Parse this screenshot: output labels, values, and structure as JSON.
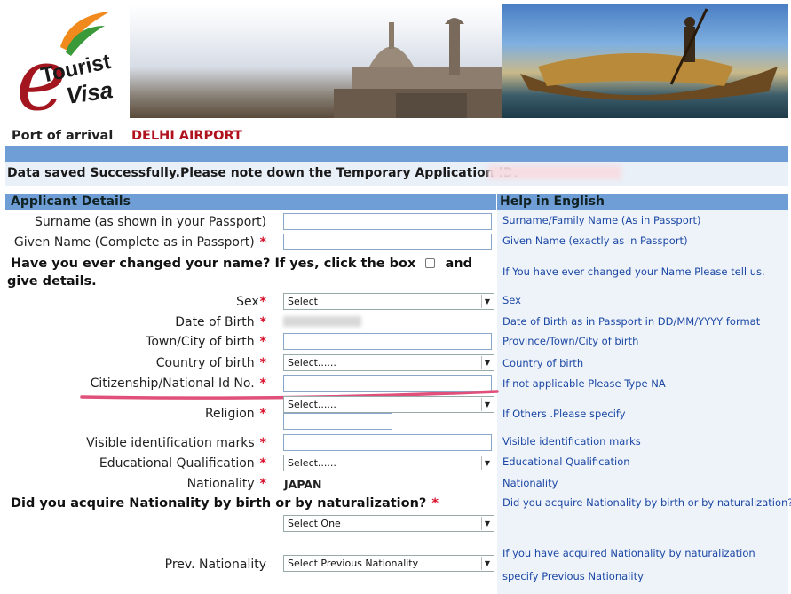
{
  "header": {
    "logo_line1": "e",
    "logo_line2": "Tourist",
    "logo_line3": "Visa"
  },
  "port": {
    "label": "Port of arrival",
    "value": "DELHI AIRPORT"
  },
  "notice": {
    "text": "Data saved Successfully.Please note down the Temporary Application ID:"
  },
  "section": {
    "left_title": "Applicant Details",
    "right_title": "Help in English"
  },
  "fields": {
    "surname_label": "Surname (as shown in your Passport)",
    "surname_help": "Surname/Family Name (As in Passport)",
    "given_label": "Given Name (Complete as in Passport)",
    "given_help": "Given Name (exactly as in Passport)",
    "changed_label_1": "Have you ever changed your name? If yes, click the box",
    "changed_label_and": "and",
    "changed_label_2": "give details.",
    "changed_help": "If You have ever changed your Name Please tell us.",
    "sex_label": "Sex",
    "sex_value": "Select",
    "sex_help": "Sex",
    "dob_label": "Date of Birth",
    "dob_help": "Date of Birth as in Passport in DD/MM/YYYY format",
    "town_label": "Town/City of birth",
    "town_help": "Province/Town/City of birth",
    "country_label": "Country of birth",
    "country_value": "Select......",
    "country_help": "Country of birth",
    "citizen_label": "Citizenship/National Id No.",
    "citizen_help": "If not applicable Please Type NA",
    "religion_label": "Religion",
    "religion_value": "Select......",
    "religion_help": "If Others .Please specify",
    "marks_label": "Visible identification marks",
    "marks_help": "Visible identification marks",
    "edu_label": "Educational Qualification",
    "edu_value": "Select......",
    "edu_help": "Educational Qualification",
    "nationality_label": "Nationality",
    "nationality_value": "JAPAN",
    "nationality_help": "Nationality",
    "acquire_label": "Did you acquire Nationality by birth or by naturalization?",
    "acquire_help": "Did you acquire Nationality by birth or by naturalization?",
    "acquire_value": "Select One",
    "prev_label": "Prev. Nationality",
    "prev_value": "Select Previous Nationality",
    "prev_help_1": "If you have acquired Nationality by naturalization",
    "prev_help_2": "specify Previous Nationality"
  },
  "required_mark": "*",
  "colors": {
    "section_blue": "#6f9dd6",
    "help_text": "#1c48a4",
    "required": "#d8102a",
    "port_value": "#b0121e",
    "underline": "#e0507a"
  }
}
